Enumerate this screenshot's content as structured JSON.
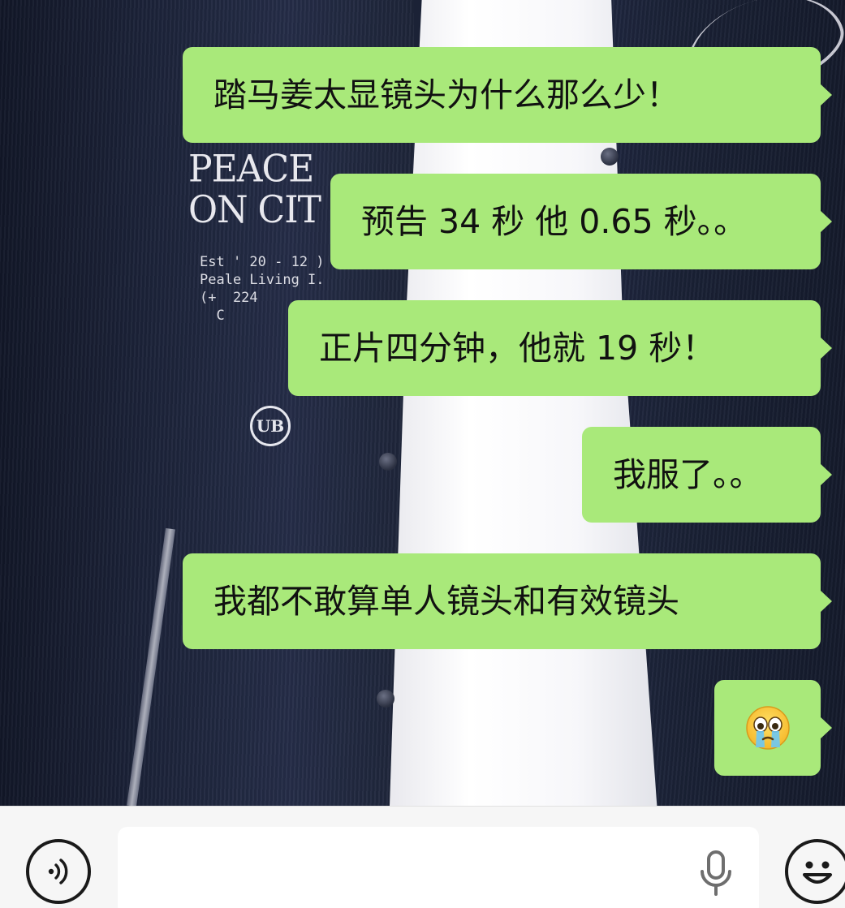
{
  "chat": {
    "messages": [
      {
        "text": "踏马姜太显镜头为什么那么少！"
      },
      {
        "text": "预告 34 秒 他 0.65 秒。。"
      },
      {
        "text": "正片四分钟，他就 19 秒！"
      },
      {
        "text": "我服了。。"
      },
      {
        "text": "我都不敢算单人镜头和有效镜头"
      },
      {
        "emoji": "crying-face"
      }
    ],
    "bubble_color": "#a9e97a"
  },
  "background": {
    "print_line1": "PEACE",
    "print_line2": "ON CIT",
    "print_small": "Est ' 20 - 12 ) F\nPeale Living I.\n(+  224\n  C",
    "badge": "UB"
  },
  "input_bar": {
    "text_value": "",
    "icons": [
      "voice-icon",
      "microphone-icon",
      "emoji-icon"
    ]
  }
}
